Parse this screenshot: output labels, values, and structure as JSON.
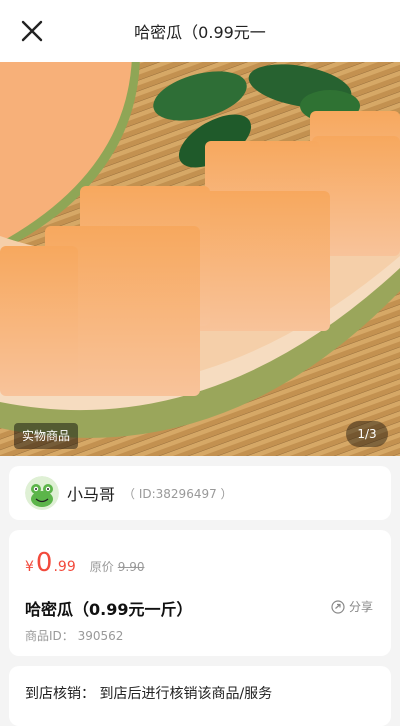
{
  "header": {
    "title": "哈密瓜（0.99元一"
  },
  "hero": {
    "tag": "实物商品",
    "pager": "1/3"
  },
  "seller": {
    "name": "小马哥",
    "id_text": "（ ID:38296497 ）"
  },
  "product": {
    "currency": "¥",
    "price_int": "0",
    "price_dec": ".99",
    "orig_label": "原价",
    "orig_price": "9.90",
    "title": "哈密瓜（0.99元一斤）",
    "share_label": "分享",
    "id_text": "商品ID：  390562"
  },
  "redeem": {
    "text": "到店核销：  到店后进行核销该商品/服务"
  },
  "colors": {
    "price": "#f24a3c",
    "melon": "#f4a264",
    "mat": "#c9985a"
  }
}
